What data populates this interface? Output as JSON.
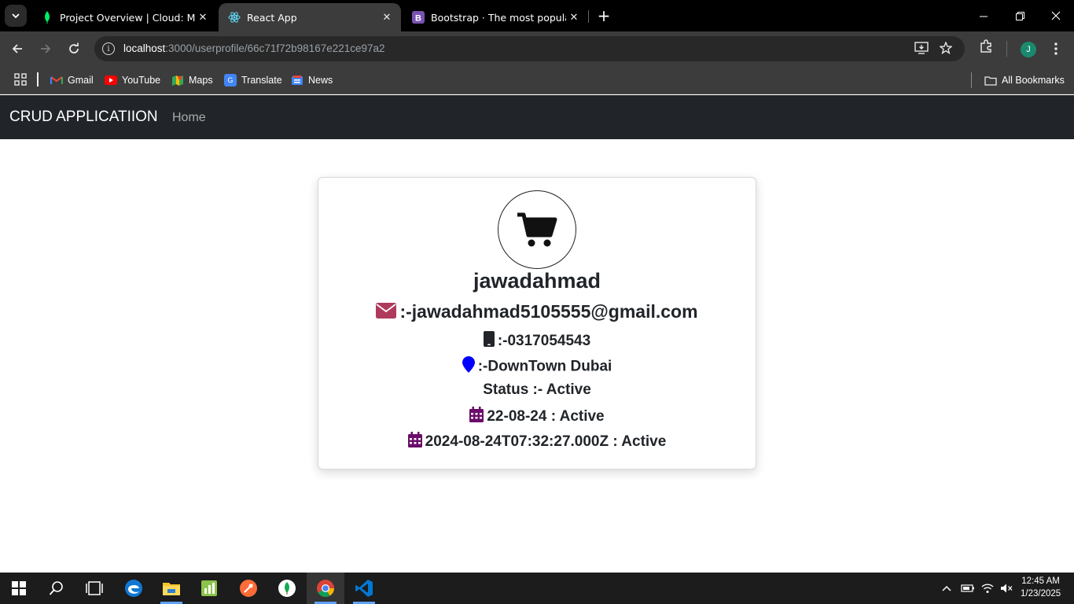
{
  "browser": {
    "tabs": [
      {
        "title": "Project Overview | Cloud: Mong",
        "icon": "mongodb-leaf-icon",
        "active": false
      },
      {
        "title": "React App",
        "icon": "react-icon",
        "active": true
      },
      {
        "title": "Bootstrap · The most popular H",
        "icon": "bootstrap-icon",
        "active": false
      }
    ],
    "address": {
      "host": "localhost",
      "path": ":3000/userprofile/66c71f72b98167e221ce97a2"
    },
    "profile_initial": "J",
    "bookmarks": [
      {
        "label": "Gmail",
        "icon": "gmail-icon"
      },
      {
        "label": "YouTube",
        "icon": "youtube-icon"
      },
      {
        "label": "Maps",
        "icon": "maps-icon"
      },
      {
        "label": "Translate",
        "icon": "translate-icon"
      },
      {
        "label": "News",
        "icon": "news-icon"
      }
    ],
    "all_bookmarks": "All Bookmarks"
  },
  "app": {
    "brand": "CRUD APPLICATIION",
    "nav": {
      "home": "Home"
    }
  },
  "profile": {
    "avatar_icon": "shopping-cart-icon",
    "username": "jawadahmad",
    "email": ":-jawadahmad5105555@gmail.com",
    "phone": ":-0317054543",
    "address": ":-DownTown Dubai",
    "status": "Status  :- Active",
    "date_short": "22-08-24  : Active",
    "date_iso": "2024-08-24T07:32:27.000Z  : Active",
    "colors": {
      "email_icon": "#b03a5b",
      "phone_icon": "#212529",
      "location_icon": "#0000ff",
      "calendar_icon": "#6a0d6a"
    }
  },
  "taskbar": {
    "clock_time": "12:45 AM",
    "clock_date": "1/23/2025"
  }
}
